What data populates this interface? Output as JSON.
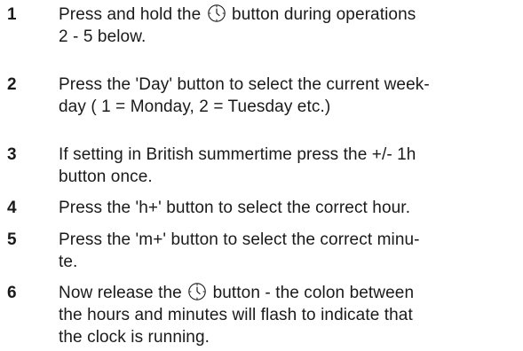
{
  "steps": [
    {
      "number": "1",
      "lines": [
        {
          "before": "Press and hold the",
          "icon": "clock-icon",
          "after": "button during operations"
        },
        {
          "text": "2 - 5 below."
        }
      ]
    },
    {
      "number": "2",
      "lines": [
        {
          "text": "Press the 'Day' button to select the current week-"
        },
        {
          "text": "day ( 1 = Monday, 2 = Tuesday etc.)"
        }
      ]
    },
    {
      "number": "3",
      "lines": [
        {
          "text": "If setting in British summertime press the +/- 1h"
        },
        {
          "text": "button once."
        }
      ]
    },
    {
      "number": "4",
      "lines": [
        {
          "text": "Press the 'h+' button to select the correct hour."
        }
      ]
    },
    {
      "number": "5",
      "lines": [
        {
          "text": "Press the 'm+' button to select the correct minu-"
        },
        {
          "text": "te."
        }
      ]
    },
    {
      "number": "6",
      "lines": [
        {
          "before": "Now release the",
          "icon": "clock-icon",
          "after": "button - the colon between"
        },
        {
          "text": "the hours and minutes will flash to indicate that"
        },
        {
          "text": "the clock is running."
        }
      ]
    }
  ]
}
